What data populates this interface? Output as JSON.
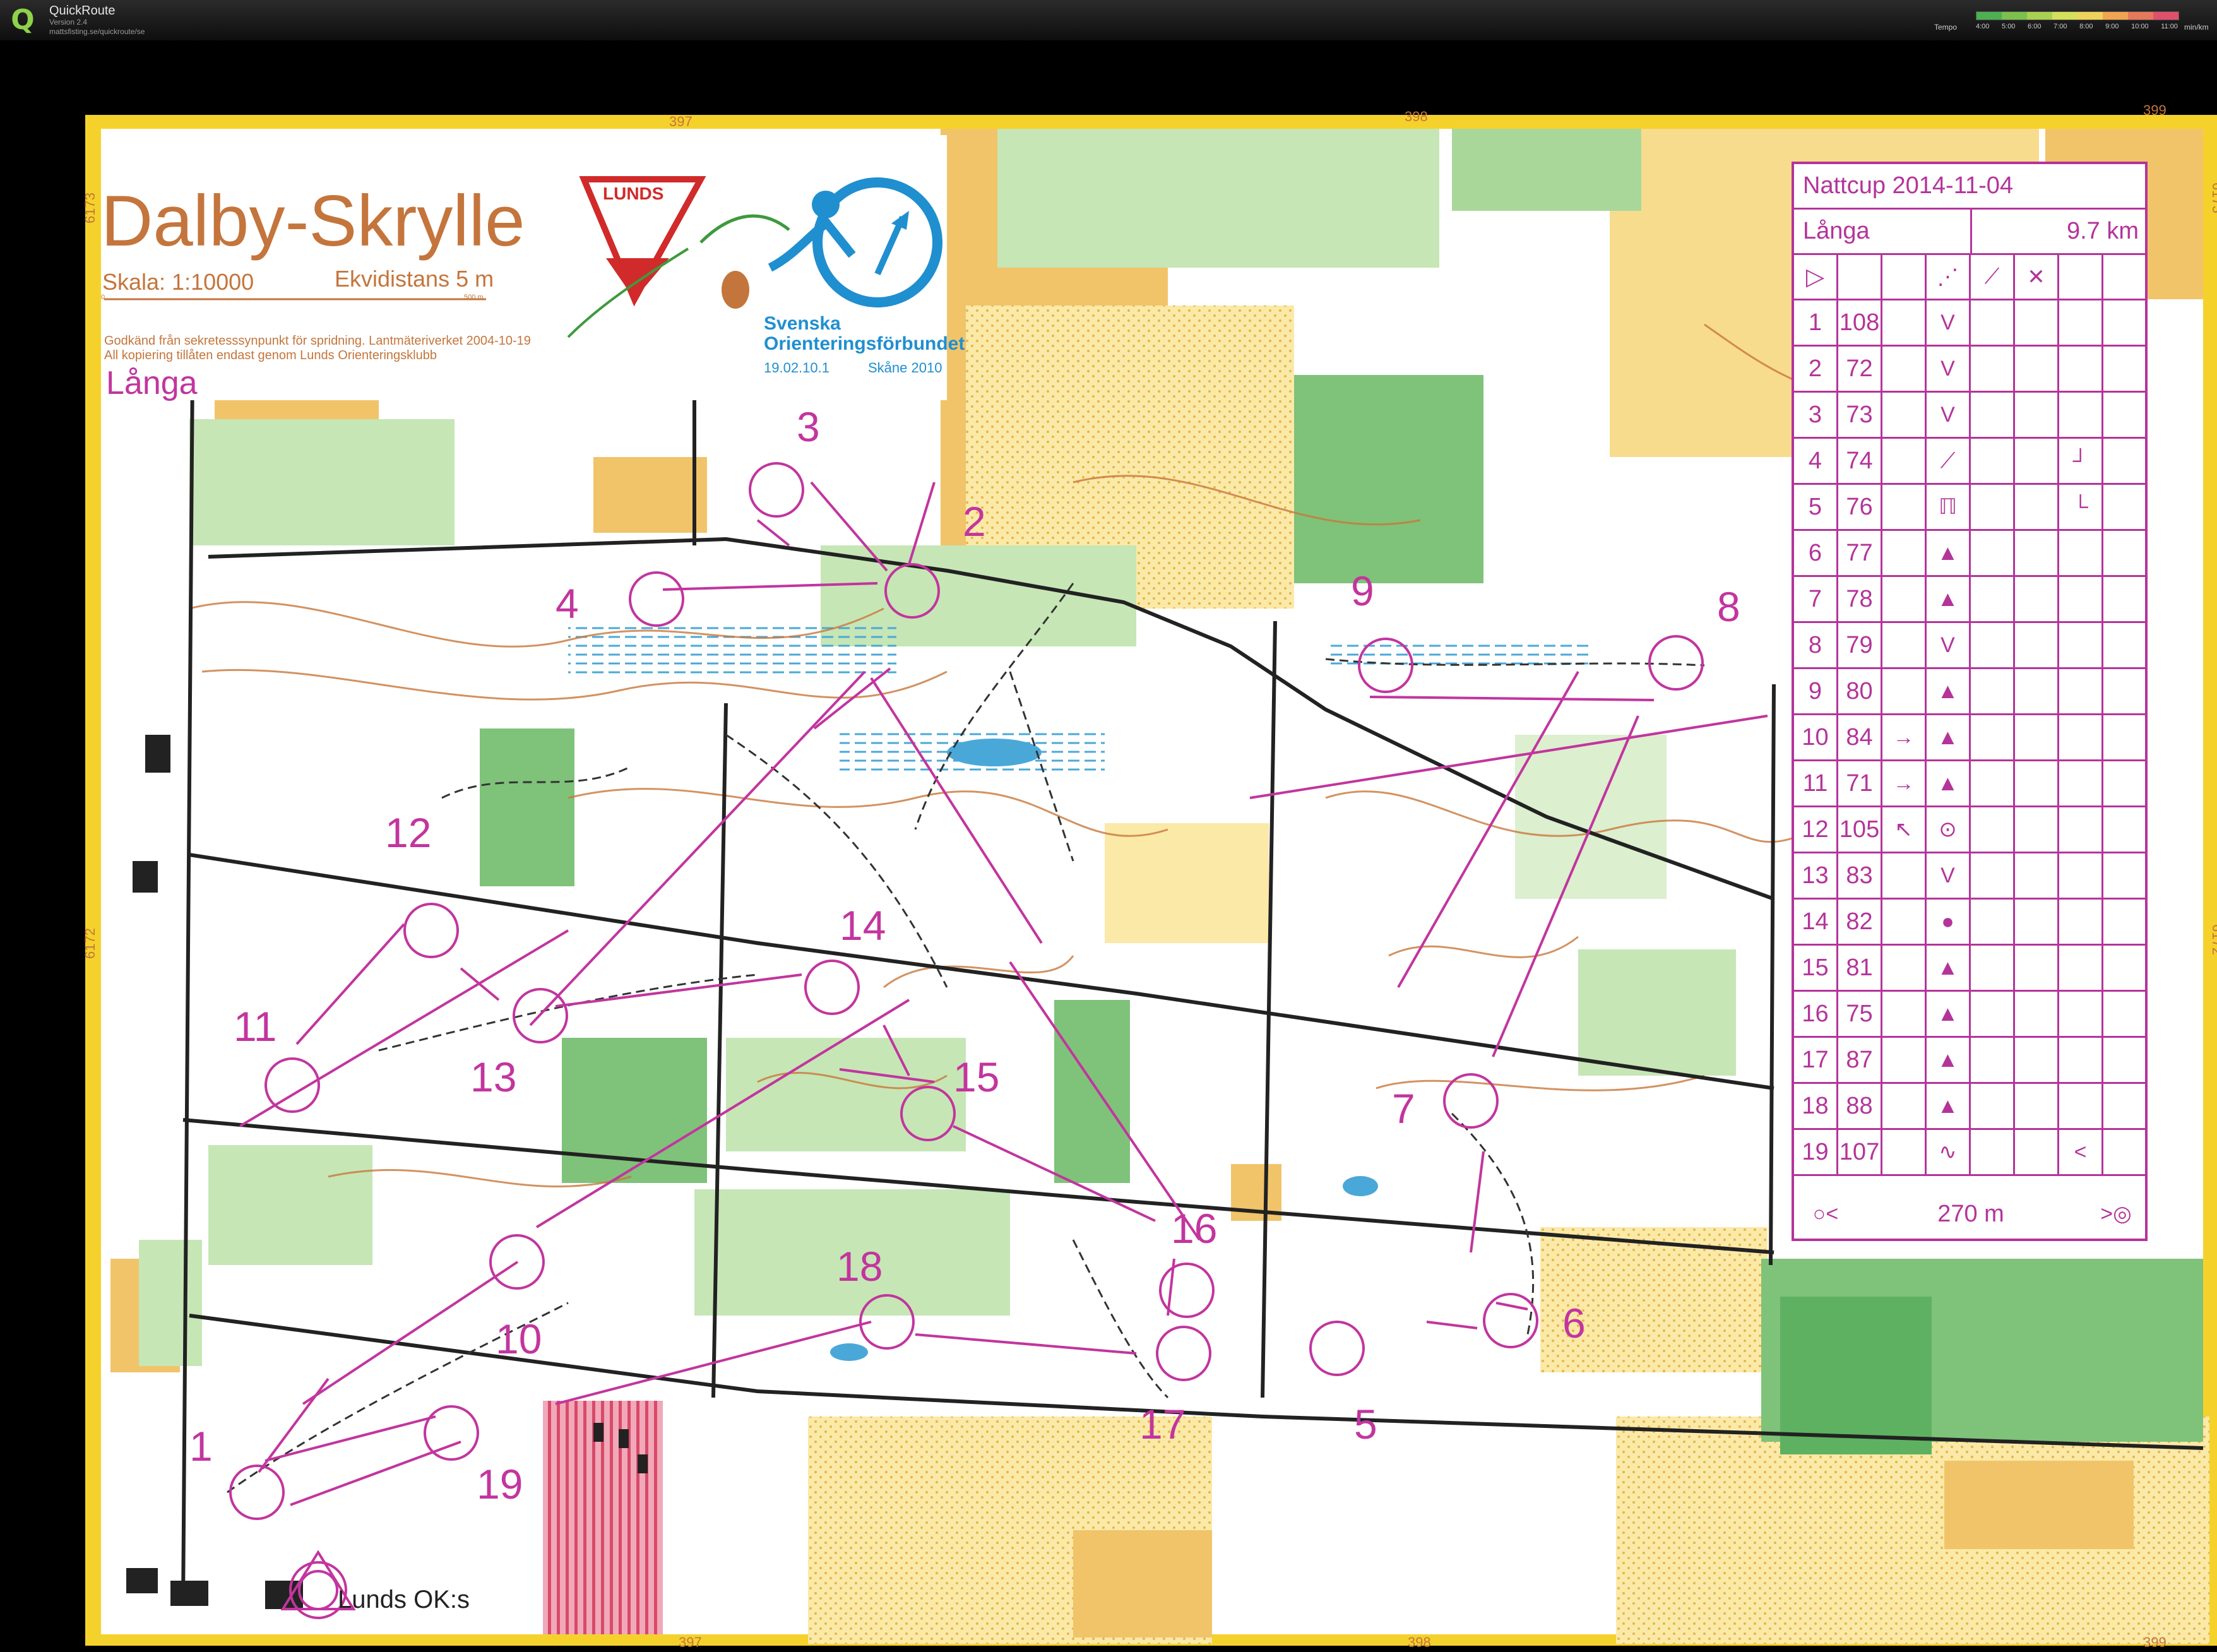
{
  "app": {
    "name": "QuickRoute",
    "version": "Version 2.4",
    "url": "mattsfisting.se/quickroute/se",
    "logo_icon": "quickroute-q-logo-icon"
  },
  "tempo_legend": {
    "title": "Tempo",
    "ticks": [
      "4:00",
      "5:00",
      "6:00",
      "7:00",
      "8:00",
      "9:00",
      "10:00",
      "11:00"
    ],
    "unit": "min/km",
    "colors": [
      "#4caf50",
      "#7cc04d",
      "#a8d14f",
      "#d5e05a",
      "#f0d25a",
      "#f0a450",
      "#e8785a",
      "#e0506a"
    ]
  },
  "map": {
    "title": "Dalby-Skrylle",
    "scale": "Skala: 1:10000",
    "equidistance": "Ekvidistans 5 m",
    "scalebar_start": "0",
    "scalebar_end": "500 m",
    "permit_line1": "Godkänd från sekretesssynpunkt för spridning. Lantmäteriverket 2004-10-19",
    "permit_line2": "All kopiering tillåten endast genom Lunds Orienteringsklubb",
    "course_name": "Långa",
    "club_logo_top": "LUNDS",
    "club_logo_bottom": "OK",
    "federation_line1": "Svenska",
    "federation_line2": "Orienteringsförbundet",
    "federation_code": "19.02.10.1",
    "federation_area": "Skåne 2010",
    "grid_top": [
      "397",
      "398",
      "399"
    ],
    "grid_bottom": [
      "397",
      "398",
      "399"
    ],
    "grid_left": [
      "6173",
      "6172"
    ],
    "grid_right": [
      "6173",
      "6172"
    ],
    "finish_label": "Lunds OK:s",
    "control_numbers": [
      "1",
      "2",
      "3",
      "4",
      "5",
      "6",
      "7",
      "8",
      "9",
      "10",
      "11",
      "12",
      "13",
      "14",
      "15",
      "16",
      "17",
      "18",
      "19"
    ],
    "colors": {
      "course": "#c2359e",
      "paper": "#ffffff",
      "border": "#f5d22b",
      "open_land": "#f1c46a",
      "rough_open": "#fbe9a8",
      "green": "#7fc27a",
      "light_green": "#c6e6b6",
      "water": "#4aa8d8",
      "contour": "#c8773a",
      "road": "#222222"
    }
  },
  "description_sheet": {
    "event": "Nattcup 2014-11-04",
    "course": "Långa",
    "length": "9.7 km",
    "start_icon": "start-triangle-icon",
    "header_icons": [
      "dashed-line-icon",
      "crossing-icon",
      "cross-x-icon"
    ],
    "rows": [
      {
        "num": "1",
        "code": "108",
        "dir": "",
        "feature": "V",
        "extra": ""
      },
      {
        "num": "2",
        "code": "72",
        "dir": "",
        "feature": "V",
        "extra": ""
      },
      {
        "num": "3",
        "code": "73",
        "dir": "",
        "feature": "V",
        "extra": ""
      },
      {
        "num": "4",
        "code": "74",
        "dir": "",
        "feature": "⟋",
        "extra": "┘"
      },
      {
        "num": "5",
        "code": "76",
        "dir": "",
        "feature": "ℿ",
        "extra": "└"
      },
      {
        "num": "6",
        "code": "77",
        "dir": "",
        "feature": "▲",
        "extra": ""
      },
      {
        "num": "7",
        "code": "78",
        "dir": "",
        "feature": "▲",
        "extra": ""
      },
      {
        "num": "8",
        "code": "79",
        "dir": "",
        "feature": "V",
        "extra": ""
      },
      {
        "num": "9",
        "code": "80",
        "dir": "",
        "feature": "▲",
        "extra": ""
      },
      {
        "num": "10",
        "code": "84",
        "dir": "→",
        "feature": "▲",
        "extra": ""
      },
      {
        "num": "11",
        "code": "71",
        "dir": "→",
        "feature": "▲",
        "extra": ""
      },
      {
        "num": "12",
        "code": "105",
        "dir": "↖",
        "feature": "⊙",
        "extra": ""
      },
      {
        "num": "13",
        "code": "83",
        "dir": "",
        "feature": "V",
        "extra": ""
      },
      {
        "num": "14",
        "code": "82",
        "dir": "",
        "feature": "●",
        "extra": ""
      },
      {
        "num": "15",
        "code": "81",
        "dir": "",
        "feature": "▲",
        "extra": ""
      },
      {
        "num": "16",
        "code": "75",
        "dir": "",
        "feature": "▲",
        "extra": ""
      },
      {
        "num": "17",
        "code": "87",
        "dir": "",
        "feature": "▲",
        "extra": ""
      },
      {
        "num": "18",
        "code": "88",
        "dir": "",
        "feature": "▲",
        "extra": ""
      },
      {
        "num": "19",
        "code": "107",
        "dir": "",
        "feature": "∿",
        "extra": "<"
      }
    ],
    "finish_distance": "270 m",
    "finish_left_icon": "finish-funnel-icon",
    "finish_right_icon": "finish-double-circle-icon"
  }
}
